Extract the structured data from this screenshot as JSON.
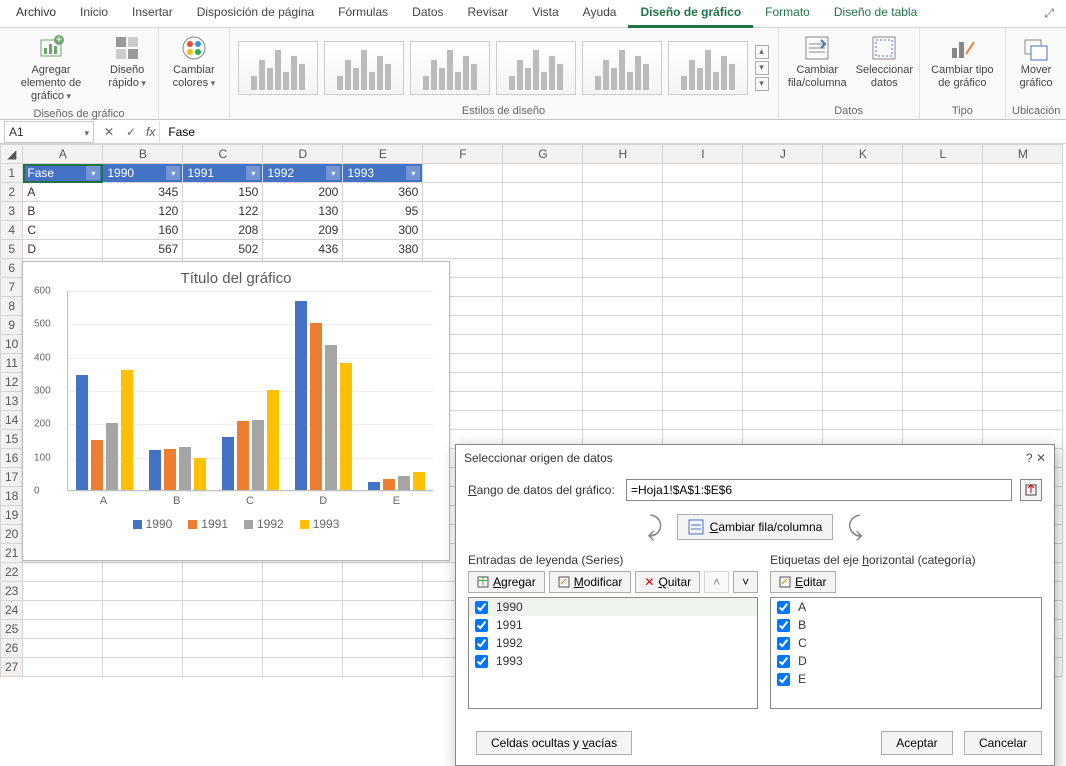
{
  "ribbon": {
    "tabs": [
      "Archivo",
      "Inicio",
      "Insertar",
      "Disposición de página",
      "Fórmulas",
      "Datos",
      "Revisar",
      "Vista",
      "Ayuda",
      "Diseño de gráfico",
      "Formato",
      "Diseño de tabla"
    ],
    "active_tab": "Diseño de gráfico",
    "groups": {
      "g1": {
        "label": "Diseños de gráfico",
        "btn_add": "Agregar elemento de gráfico",
        "btn_quick": "Diseño rápido"
      },
      "g2": {
        "btn_colors": "Cambiar colores"
      },
      "g3": {
        "label": "Estilos de diseño"
      },
      "g4": {
        "label": "Datos",
        "btn_swap": "Cambiar fila/columna",
        "btn_select": "Seleccionar datos"
      },
      "g5": {
        "label": "Tipo",
        "btn_type": "Cambiar tipo de gráfico"
      },
      "g6": {
        "label": "Ubicación",
        "btn_move": "Mover gráfico"
      }
    }
  },
  "formula_bar": {
    "name_box": "A1",
    "formula": "Fase"
  },
  "sheet": {
    "cols": [
      "A",
      "B",
      "C",
      "D",
      "E",
      "F",
      "G",
      "H",
      "I",
      "J",
      "K",
      "L",
      "M"
    ],
    "headers": [
      "Fase",
      "1990",
      "1991",
      "1992",
      "1993"
    ],
    "rows": [
      {
        "r": 2,
        "fase": "A",
        "v": [
          345,
          150,
          200,
          360
        ]
      },
      {
        "r": 3,
        "fase": "B",
        "v": [
          120,
          122,
          130,
          95
        ]
      },
      {
        "r": 4,
        "fase": "C",
        "v": [
          160,
          208,
          209,
          300
        ]
      },
      {
        "r": 5,
        "fase": "D",
        "v": [
          567,
          502,
          436,
          380
        ]
      },
      {
        "r": 6,
        "fase": "E",
        "v": [
          25,
          32,
          42,
          55
        ]
      }
    ]
  },
  "chart_data": {
    "type": "bar",
    "title": "Título del gráfico",
    "categories": [
      "A",
      "B",
      "C",
      "D",
      "E"
    ],
    "series": [
      {
        "name": "1990",
        "color": "#4472c4",
        "values": [
          345,
          120,
          160,
          567,
          25
        ]
      },
      {
        "name": "1991",
        "color": "#ed7d31",
        "values": [
          150,
          122,
          208,
          502,
          32
        ]
      },
      {
        "name": "1992",
        "color": "#a5a5a5",
        "values": [
          200,
          130,
          209,
          436,
          42
        ]
      },
      {
        "name": "1993",
        "color": "#ffc000",
        "values": [
          360,
          95,
          300,
          380,
          55
        ]
      }
    ],
    "yticks": [
      0,
      100,
      200,
      300,
      400,
      500,
      600
    ],
    "ylim": [
      0,
      600
    ]
  },
  "dialog": {
    "title": "Seleccionar origen de datos",
    "range_label_pre": "R",
    "range_label_post": "ango de datos del gráfico:",
    "range_value": "=Hoja1!$A$1:$E$6",
    "swap_pre": "C",
    "swap_post": "ambiar fila/columna",
    "series_title": "Entradas de leyenda (Series)",
    "categories_title_pre": "Etiquetas del eje ",
    "categories_title_u": "h",
    "categories_title_post": "orizontal (categoría)",
    "btn_add_pre": "A",
    "btn_add_post": "gregar",
    "btn_mod_pre": "M",
    "btn_mod_post": "odificar",
    "btn_del_pre": "Q",
    "btn_del_post": "uitar",
    "btn_edit_pre": "E",
    "btn_edit_post": "ditar",
    "series": [
      "1990",
      "1991",
      "1992",
      "1993"
    ],
    "categories": [
      "A",
      "B",
      "C",
      "D",
      "E"
    ],
    "hidden_pre": "Celdas ocultas y ",
    "hidden_u": "v",
    "hidden_post": "acías",
    "accept": "Aceptar",
    "cancel": "Cancelar"
  }
}
